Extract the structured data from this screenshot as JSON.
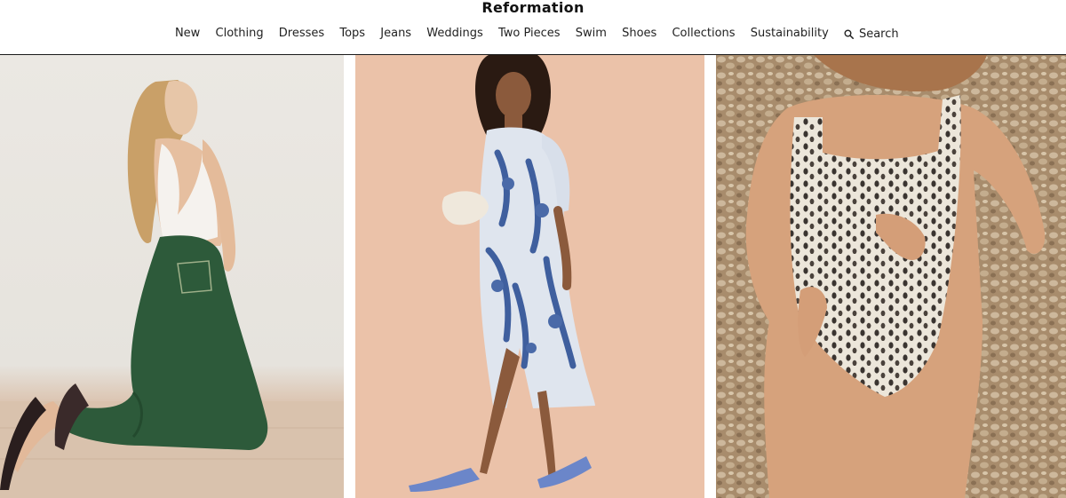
{
  "brand": {
    "name": "Reformation"
  },
  "nav": {
    "items": [
      "New",
      "Clothing",
      "Dresses",
      "Tops",
      "Jeans",
      "Weddings",
      "Two Pieces",
      "Swim",
      "Shoes",
      "Collections",
      "Sustainability"
    ],
    "search_label": "Search"
  },
  "icons": {
    "search": "search-icon"
  },
  "colors": {
    "text": "#111111",
    "background": "#ffffff",
    "divider": "#1a1a1a"
  }
}
